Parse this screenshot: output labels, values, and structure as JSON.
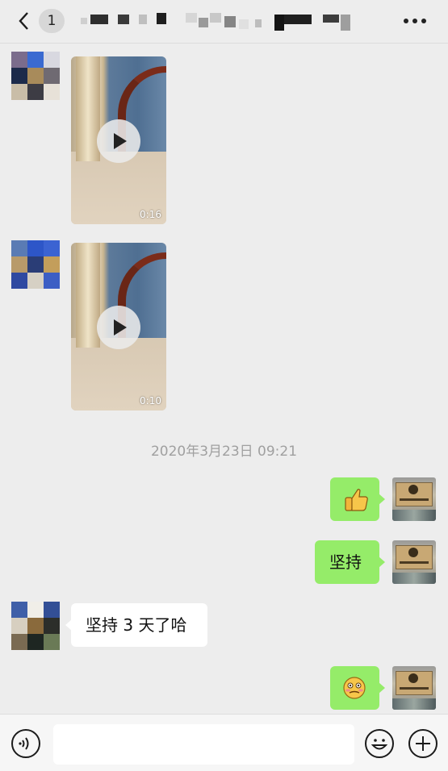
{
  "header": {
    "back_badge": "1",
    "more_icon": "more-dots-icon"
  },
  "messages": [
    {
      "type": "video",
      "side": "left",
      "duration": "0:16"
    },
    {
      "type": "video",
      "side": "left",
      "duration": "0:10"
    },
    {
      "type": "timestamp",
      "text": "2020年3月23日 09:21"
    },
    {
      "type": "emoji",
      "side": "right",
      "emoji": "thumbs-up"
    },
    {
      "type": "text",
      "side": "right",
      "text": "坚持"
    },
    {
      "type": "text",
      "side": "left",
      "text": "坚持 3 天了哈"
    },
    {
      "type": "emoji",
      "side": "right",
      "emoji": "awkward-face"
    }
  ],
  "input_bar": {
    "voice_icon": "voice-icon",
    "emoji_icon": "emoji-icon",
    "plus_icon": "plus-icon",
    "placeholder": ""
  },
  "colors": {
    "background": "#ededed",
    "bubble_green": "#95ec69",
    "bubble_white": "#ffffff",
    "timestamp": "#a0a0a0"
  }
}
